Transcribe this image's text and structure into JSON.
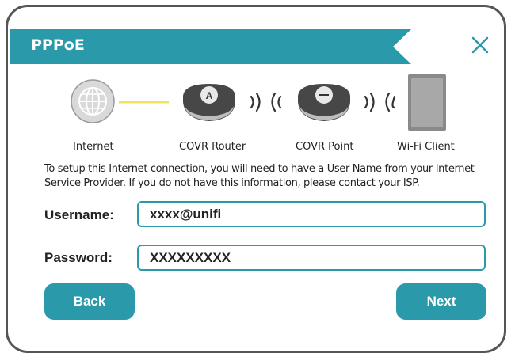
{
  "dialog": {
    "title": "PPPoE",
    "banner_color": "#2a9aab"
  },
  "diagram": {
    "nodes": [
      {
        "label": "Internet",
        "icon": "globe-icon"
      },
      {
        "label": "COVR Router",
        "icon": "router-icon",
        "badge": "A"
      },
      {
        "label": "COVR Point",
        "icon": "point-icon"
      },
      {
        "label": "Wi-Fi Client",
        "icon": "device-icon"
      }
    ],
    "link_color": "#f2e45a"
  },
  "instructions": "To setup this Internet connection, you will need to have a User Name from your Internet Service Provider. If you do not have this information, please contact your ISP.",
  "form": {
    "username_label": "Username:",
    "username_value": "xxxx@unifi",
    "password_label": "Password:",
    "password_value": "XXXXXXXXX"
  },
  "buttons": {
    "back_label": "Back",
    "next_label": "Next"
  }
}
